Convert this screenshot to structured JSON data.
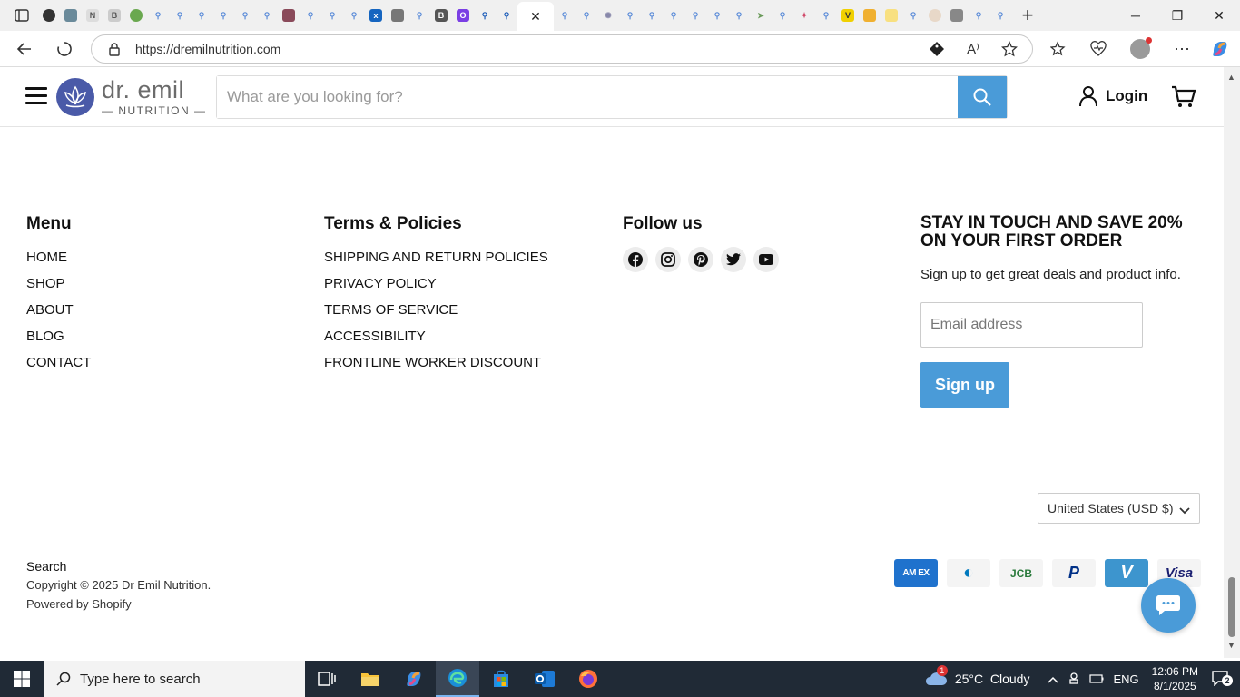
{
  "browser": {
    "url": "https://dremilnutrition.com",
    "controls": {
      "minimize": "─",
      "maximize": "❐",
      "close": "✕"
    }
  },
  "header": {
    "logo_name": "dr. emil",
    "logo_sub": "— NUTRITION —",
    "search_placeholder": "What are you looking for?",
    "login_label": "Login"
  },
  "footer": {
    "menu": {
      "title": "Menu",
      "items": [
        "HOME",
        "SHOP",
        "ABOUT",
        "BLOG",
        "CONTACT"
      ]
    },
    "policies": {
      "title": "Terms & Policies",
      "items": [
        "SHIPPING AND RETURN POLICIES",
        "PRIVACY POLICY",
        "TERMS OF SERVICE",
        "ACCESSIBILITY",
        "FRONTLINE WORKER DISCOUNT"
      ]
    },
    "follow": {
      "title": "Follow us",
      "icons": [
        "facebook-icon",
        "instagram-icon",
        "pinterest-icon",
        "twitter-icon",
        "youtube-icon"
      ]
    },
    "newsletter": {
      "title": "STAY IN TOUCH AND SAVE 20% ON YOUR FIRST ORDER",
      "text": "Sign up to get great deals and product info.",
      "email_placeholder": "Email address",
      "button": "Sign up"
    },
    "currency": "United States (USD $)",
    "bottom": {
      "search": "Search",
      "copyright": "Copyright © 2025 Dr Emil Nutrition.",
      "powered": "Powered by Shopify"
    },
    "payments": [
      {
        "name": "amex",
        "label": "AM EX",
        "bg": "#1f72cd",
        "fg": "#ffffff"
      },
      {
        "name": "diners",
        "label": "◐",
        "bg": "#f4f4f4",
        "fg": "#0079be"
      },
      {
        "name": "jcb",
        "label": "JCB",
        "bg": "#f4f4f4",
        "fg": "#2a7a3c"
      },
      {
        "name": "paypal",
        "label": "P",
        "bg": "#f4f4f4",
        "fg": "#003087"
      },
      {
        "name": "venmo",
        "label": "V",
        "bg": "#3d95ce",
        "fg": "#ffffff"
      },
      {
        "name": "visa",
        "label": "Visa",
        "bg": "#f4f4f4",
        "fg": "#1a1f71"
      }
    ]
  },
  "taskbar": {
    "search_placeholder": "Type here to search",
    "weather": "25°C  Cloudy",
    "lang": "ENG",
    "time": "12:06 PM",
    "date": "8/1/2025",
    "notifications": "2",
    "weather_badge": "1"
  },
  "colors": {
    "accent": "#4a9bd8",
    "logo": "#4a5aa8",
    "taskbar": "#202a36"
  }
}
